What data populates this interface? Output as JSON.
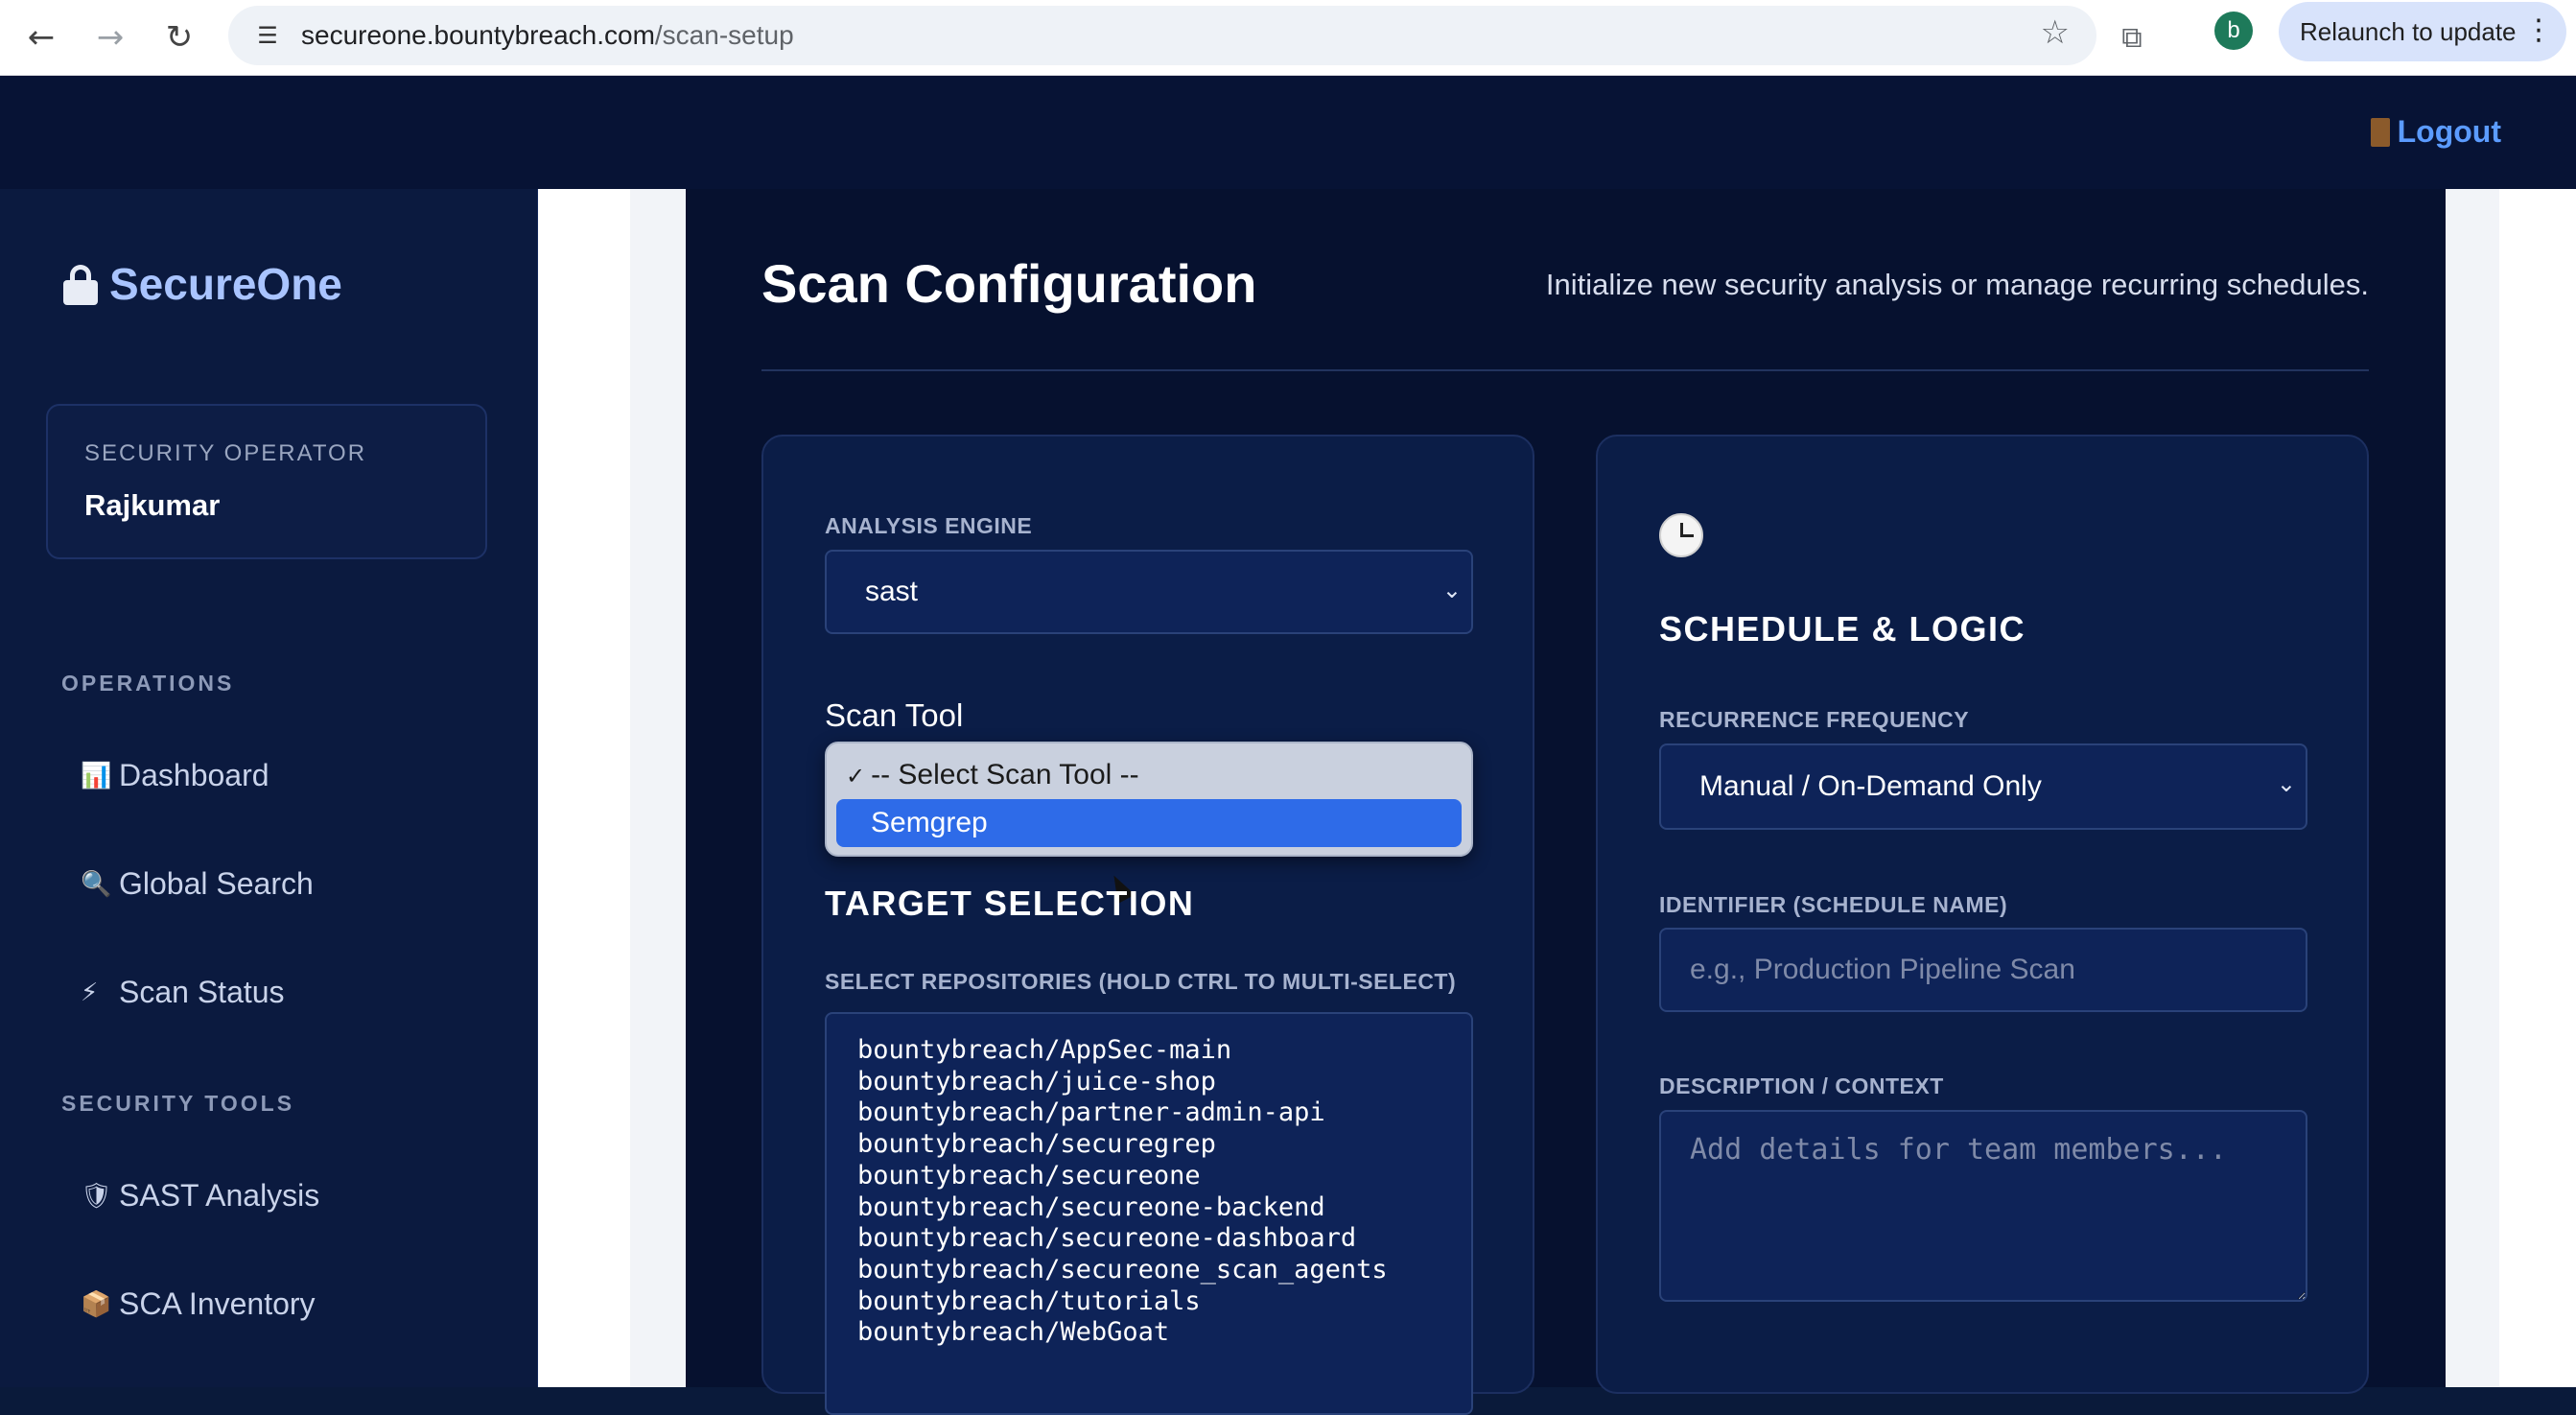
{
  "browser": {
    "url_host": "secureone.bountybreach.com",
    "url_path": "/scan-setup",
    "avatar_letter": "b",
    "relaunch_label": "Relaunch to update"
  },
  "header": {
    "logout_label": "Logout"
  },
  "sidebar": {
    "brand": "SecureOne",
    "operator_label": "SECURITY OPERATOR",
    "operator_name": "Rajkumar",
    "sections": [
      {
        "label": "OPERATIONS",
        "items": [
          {
            "icon": "📊",
            "label": "Dashboard"
          },
          {
            "icon": "🔍",
            "label": "Global Search"
          },
          {
            "icon": "⚡",
            "label": "Scan Status"
          }
        ]
      },
      {
        "label": "SECURITY TOOLS",
        "items": [
          {
            "icon": "🛡",
            "label": "SAST Analysis"
          },
          {
            "icon": "📦",
            "label": "SCA Inventory"
          }
        ]
      }
    ]
  },
  "main": {
    "title": "Scan Configuration",
    "subtitle": "Initialize new security analysis or manage recurring schedules.",
    "left_card": {
      "engine_label": "ANALYSIS ENGINE",
      "engine_value": "sast",
      "scan_tool_label": "Scan Tool",
      "scan_tool_options": [
        "-- Select Scan Tool --",
        "Semgrep"
      ],
      "scan_tool_selected": "-- Select Scan Tool --",
      "scan_tool_highlighted": "Semgrep",
      "target_title": "TARGET SELECTION",
      "repos_label": "SELECT REPOSITORIES (HOLD CTRL TO MULTI-SELECT)",
      "repos": [
        "bountybreach/AppSec-main",
        "bountybreach/juice-shop",
        "bountybreach/partner-admin-api",
        "bountybreach/securegrep",
        "bountybreach/secureone",
        "bountybreach/secureone-backend",
        "bountybreach/secureone-dashboard",
        "bountybreach/secureone_scan_agents",
        "bountybreach/tutorials",
        "bountybreach/WebGoat"
      ]
    },
    "right_card": {
      "title": "SCHEDULE & LOGIC",
      "recurrence_label": "RECURRENCE FREQUENCY",
      "recurrence_value": "Manual / On-Demand Only",
      "identifier_label": "IDENTIFIER (SCHEDULE NAME)",
      "identifier_placeholder": "e.g., Production Pipeline Scan",
      "description_label": "DESCRIPTION / CONTEXT",
      "description_placeholder": "Add details for team members..."
    }
  }
}
